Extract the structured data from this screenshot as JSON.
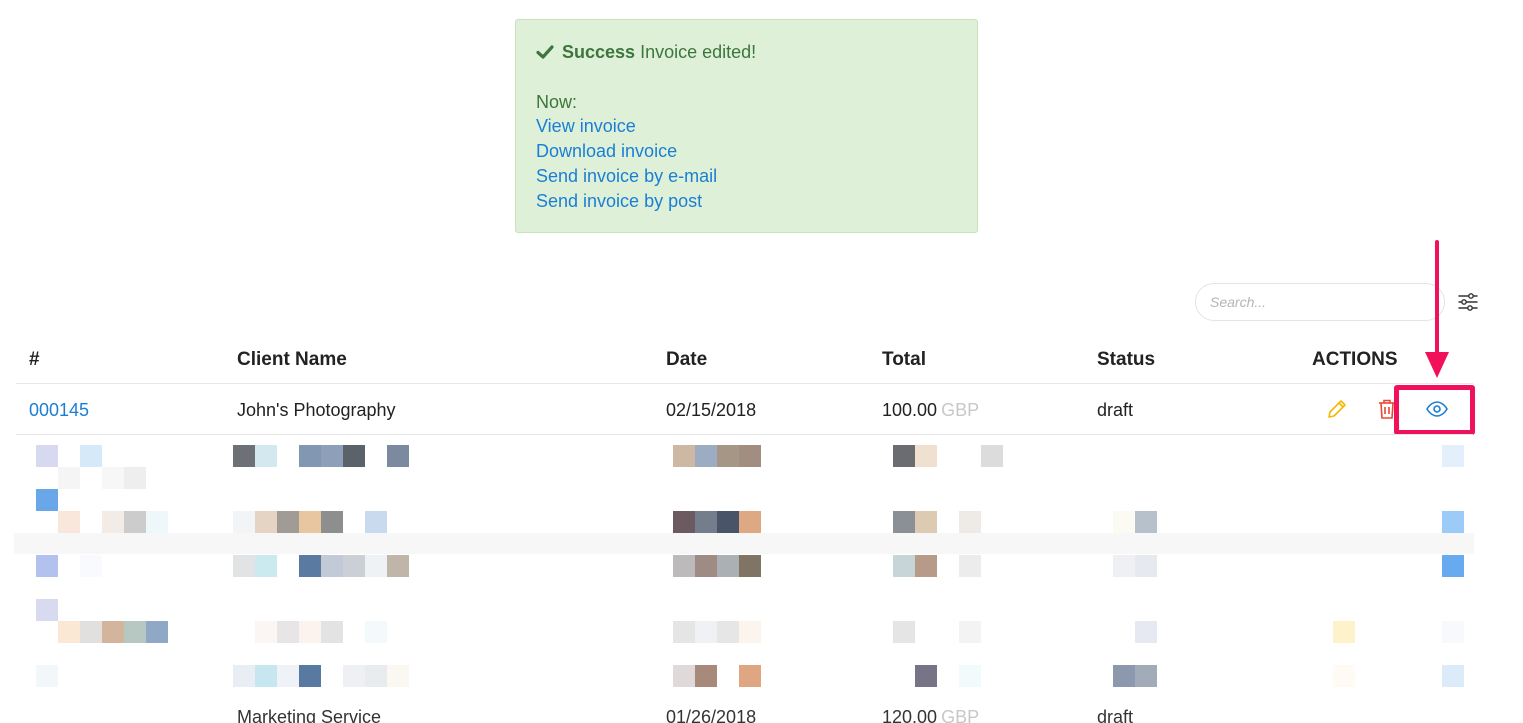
{
  "alert": {
    "title": "Success",
    "message": "Invoice edited!",
    "now_label": "Now:",
    "links": [
      "View invoice",
      "Download invoice",
      "Send invoice by e-mail",
      "Send invoice by post"
    ]
  },
  "search": {
    "placeholder": "Search..."
  },
  "table": {
    "headers": [
      "#",
      "Client Name",
      "Date",
      "Total",
      "Status",
      "ACTIONS"
    ],
    "row": {
      "number": "000145",
      "client": "John's Photography",
      "date": "02/15/2018",
      "amount": "100.00",
      "currency": "GBP",
      "status": "draft"
    },
    "bottom_row": {
      "client": "Marketing Service",
      "date": "01/26/2018",
      "amount": "120.00",
      "currency": "GBP",
      "status": "draft"
    }
  },
  "colors": {
    "accent": "#1a7fd4",
    "success_bg": "#dff0d8",
    "success_text": "#3c763d",
    "highlight": "#f0115a",
    "edit": "#f5b800",
    "delete": "#e8492f"
  },
  "icons": [
    "check-icon",
    "filter-icon",
    "edit-icon",
    "delete-icon",
    "view-icon",
    "arrow-down-icon"
  ]
}
